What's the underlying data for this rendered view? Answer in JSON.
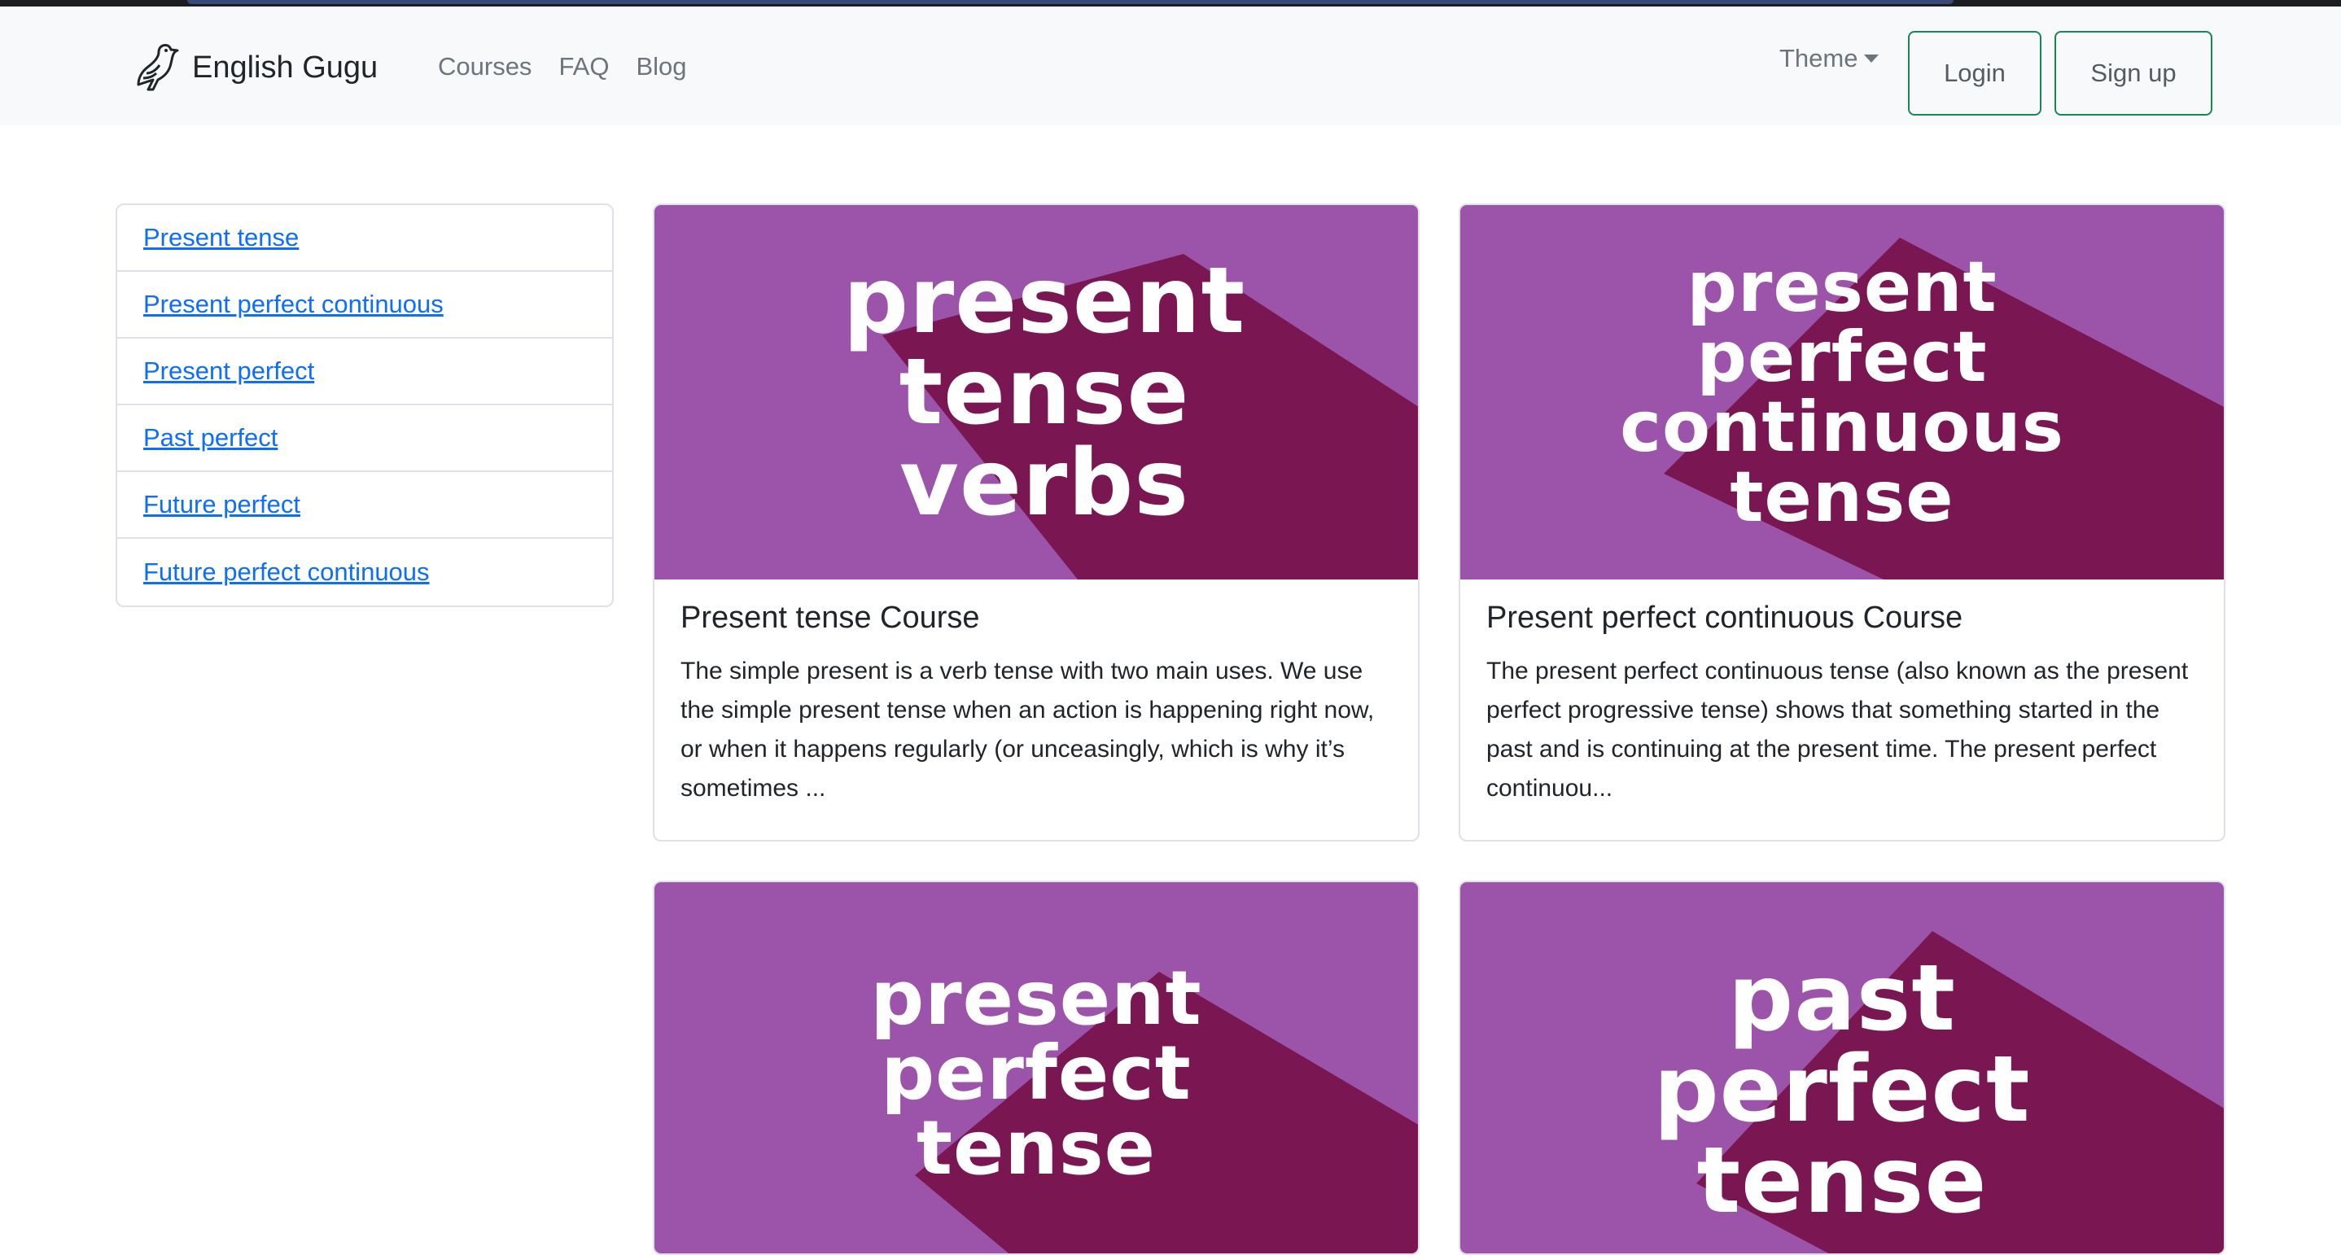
{
  "navbar": {
    "brand": "English Gugu",
    "links": [
      "Courses",
      "FAQ",
      "Blog"
    ],
    "theme_label": "Theme",
    "login_label": "Login",
    "signup_label": "Sign up"
  },
  "sidebar": {
    "items": [
      {
        "label": "Present tense"
      },
      {
        "label": "Present perfect continuous"
      },
      {
        "label": "Present perfect"
      },
      {
        "label": "Past perfect"
      },
      {
        "label": "Future perfect"
      },
      {
        "label": "Future perfect continuous"
      }
    ]
  },
  "cards": [
    {
      "image_lines": [
        "present",
        "tense",
        "verbs"
      ],
      "title": "Present tense Course",
      "text": "The simple present is a verb tense with two main uses. We use the simple present tense when an action is happening right now, or when it happens regularly (or unceasingly, which is why it’s sometimes ..."
    },
    {
      "image_lines": [
        "present",
        "perfect",
        "continuous",
        "tense"
      ],
      "title": "Present perfect continuous Course",
      "text": "The present perfect continuous tense (also known as the present perfect progressive tense) shows that something started in the past and is continuing at the present time. The present perfect continuou..."
    },
    {
      "image_lines": [
        "present",
        "perfect",
        "tense"
      ]
    },
    {
      "image_lines": [
        "past",
        "perfect",
        "tense"
      ]
    }
  ],
  "colors": {
    "image_bg": "#9b54a9",
    "image_shadow": "#7a1752",
    "link": "#0d6efd",
    "button_border": "#198754"
  }
}
